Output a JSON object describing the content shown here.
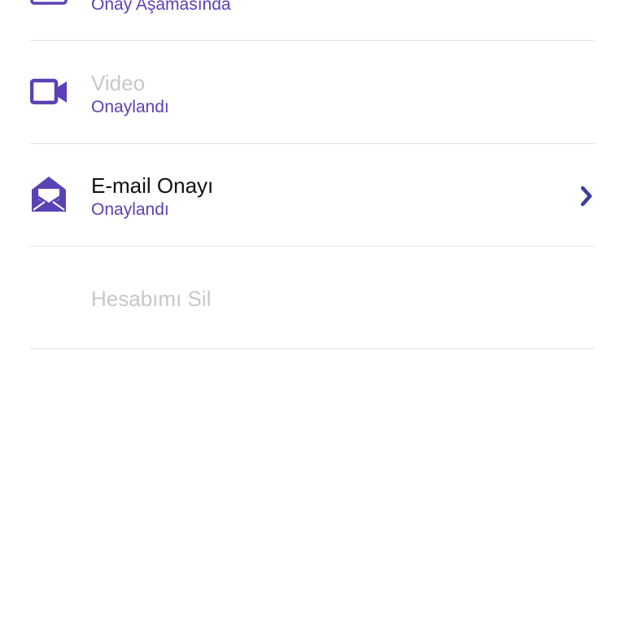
{
  "colors": {
    "accent": "#5a41b5",
    "disabled_text": "#c7c7cc",
    "primary_text": "#111111",
    "divider": "#e4e4e8"
  },
  "rows": [
    {
      "icon": "id-card-icon",
      "title": "",
      "status": "Onay Aşamasında"
    },
    {
      "icon": "video-camera-icon",
      "title": "Video",
      "status": "Onaylandı"
    },
    {
      "icon": "envelope-open-icon",
      "title": "E-mail Onayı",
      "status": "Onaylandı",
      "chevron": "chevron-right-icon"
    },
    {
      "title": "Hesabımı Sil"
    }
  ]
}
